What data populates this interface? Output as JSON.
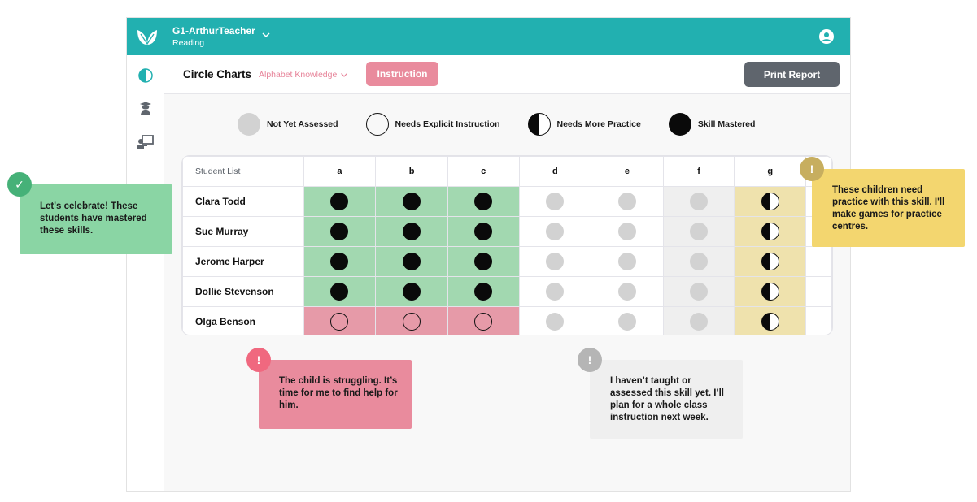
{
  "app": {
    "class_name": "G1-ArthurTeacher",
    "subject": "Reading",
    "brand_color": "#22b0b0"
  },
  "sidebar": {
    "items": [
      {
        "icon": "circle-chart-icon",
        "active": true
      },
      {
        "icon": "teacher-icon",
        "active": false
      },
      {
        "icon": "classroom-board-icon",
        "active": false
      }
    ]
  },
  "header": {
    "title": "Circle Charts",
    "skill_select": "Alphabet Knowledge",
    "instruction_button": "Instruction",
    "print_button": "Print Report"
  },
  "legend": [
    {
      "key": "not",
      "label": "Not Yet Assessed"
    },
    {
      "key": "explicit",
      "label": "Needs Explicit Instruction"
    },
    {
      "key": "practice",
      "label": "Needs More Practice"
    },
    {
      "key": "mastered",
      "label": "Skill Mastered"
    }
  ],
  "grid": {
    "name_header": "Student List",
    "skills": [
      "a",
      "b",
      "c",
      "d",
      "e",
      "f",
      "g"
    ],
    "students": [
      {
        "name": "Clara Todd",
        "statuses": [
          "mastered",
          "mastered",
          "mastered",
          "not",
          "not",
          "not",
          "practice"
        ]
      },
      {
        "name": "Sue Murray",
        "statuses": [
          "mastered",
          "mastered",
          "mastered",
          "not",
          "not",
          "not",
          "practice"
        ]
      },
      {
        "name": "Jerome Harper",
        "statuses": [
          "mastered",
          "mastered",
          "mastered",
          "not",
          "not",
          "not",
          "practice"
        ]
      },
      {
        "name": "Dollie Stevenson",
        "statuses": [
          "mastered",
          "mastered",
          "mastered",
          "not",
          "not",
          "not",
          "practice"
        ]
      },
      {
        "name": "Olga Benson",
        "statuses": [
          "explicit",
          "explicit",
          "explicit",
          "not",
          "not",
          "not",
          "practice"
        ]
      }
    ]
  },
  "notes": {
    "green": {
      "badge": "✓",
      "text": "Let's celebrate! These students have mastered these skills."
    },
    "yellow": {
      "badge": "!",
      "text": "These children need practice with this skill. I'll make games for practice centres."
    },
    "pink": {
      "badge": "!",
      "text": "The child is struggling. It’s time for me to  find help for him."
    },
    "grey": {
      "badge": "!",
      "text": "I haven’t taught or assessed this skill yet. I’ll plan for a whole class instruction next week."
    }
  }
}
